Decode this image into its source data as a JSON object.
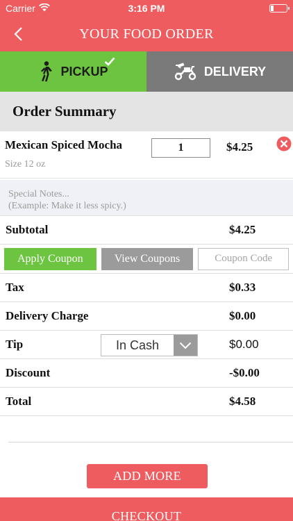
{
  "status_bar": {
    "carrier": "Carrier",
    "time": "3:16 PM"
  },
  "header": {
    "title": "YOUR FOOD ORDER"
  },
  "tabs": {
    "pickup_label": "PICKUP",
    "delivery_label": "DELIVERY"
  },
  "summary": {
    "title": "Order Summary"
  },
  "item": {
    "name": "Mexican Spiced Mocha",
    "size": "Size  12 oz",
    "quantity": "1",
    "price": "$4.25"
  },
  "notes": {
    "placeholder_line1": "Special Notes...",
    "placeholder_line2": "(Example: Make it less spicy.)"
  },
  "subtotal": {
    "label": "Subtotal",
    "value": "$4.25"
  },
  "coupons": {
    "apply_label": "Apply Coupon",
    "view_label": "View Coupons",
    "code_placeholder": "Coupon Code"
  },
  "tax": {
    "label": "Tax",
    "value": "$0.33"
  },
  "delivery_charge": {
    "label": "Delivery Charge",
    "value": "$0.00"
  },
  "tip": {
    "label": "Tip",
    "selected": "In Cash",
    "value": "$0.00"
  },
  "discount": {
    "label": "Discount",
    "value": "-$0.00"
  },
  "total": {
    "label": "Total",
    "value": "$4.58"
  },
  "actions": {
    "add_more_label": "ADD MORE",
    "checkout_label": "CHECKOUT"
  },
  "colors": {
    "brand": "#ee5c60",
    "accent_green": "#6dc441",
    "neutral_gray": "#9b9b9b"
  }
}
